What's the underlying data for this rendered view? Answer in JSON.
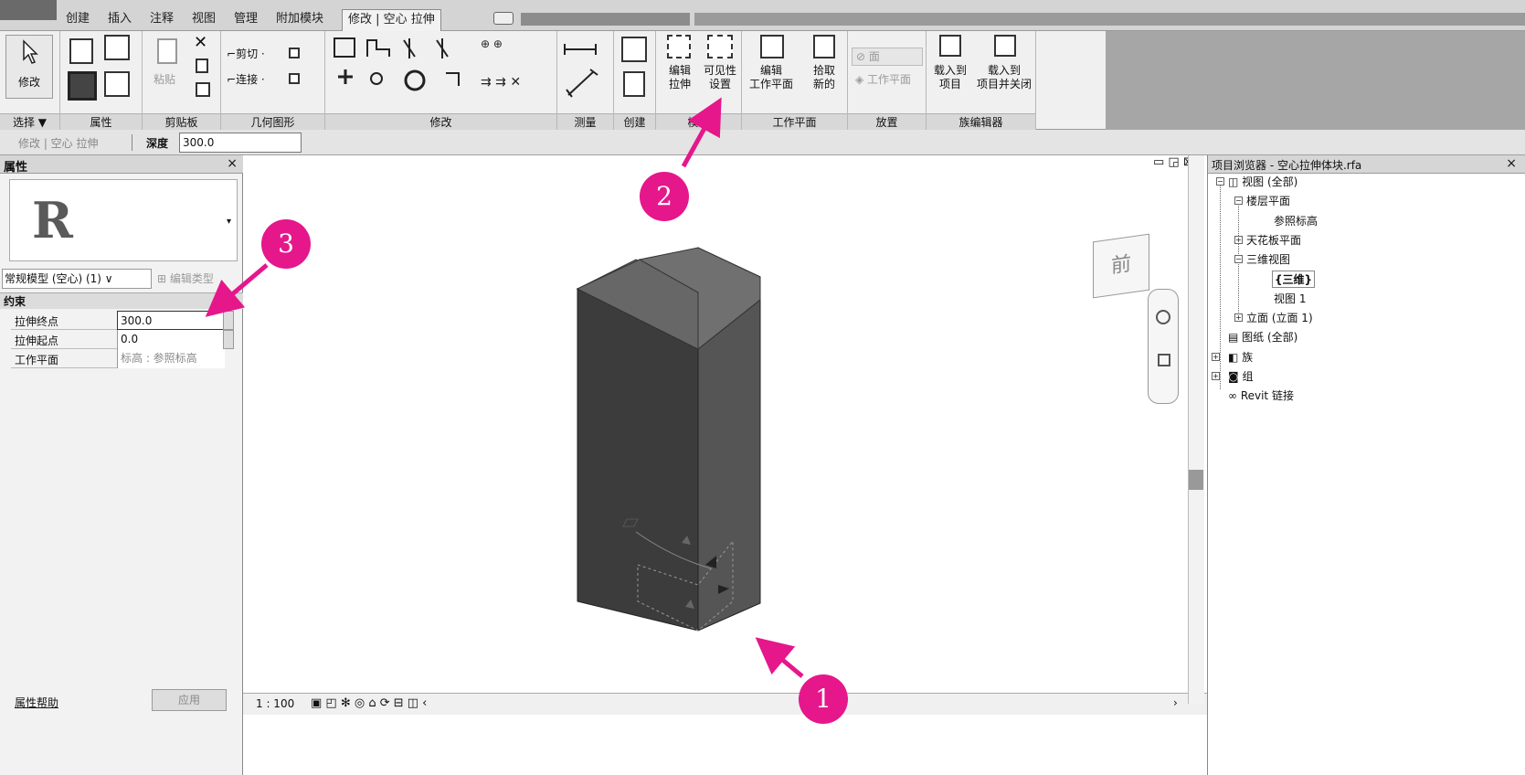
{
  "tabs": [
    "创建",
    "插入",
    "注释",
    "视图",
    "管理",
    "附加模块",
    "修改 | 空心 拉伸"
  ],
  "ribbon": {
    "modify_label": "修改",
    "paste_label": "粘贴",
    "cut_label": "剪切 ·",
    "join_label": "连接 ·",
    "edit_extrusion": [
      "编辑",
      "拉伸"
    ],
    "visibility_settings": [
      "可见性",
      "设置"
    ],
    "edit_workplane": [
      "编辑",
      "工作平面"
    ],
    "pick_new": [
      "拾取",
      "新的"
    ],
    "place_face": "面",
    "place_workplane": "工作平面",
    "load_into_project": [
      "载入到",
      "项目"
    ],
    "load_close": [
      "载入到",
      "项目并关闭"
    ],
    "panels": [
      "选择 ▼",
      "属性",
      "剪贴板",
      "几何图形",
      "修改",
      "测量",
      "创建",
      "模式",
      "工作平面",
      "放置",
      "族编辑器"
    ]
  },
  "optionbar": {
    "context": "修改 | 空心 拉伸",
    "depth_label": "深度",
    "depth_value": "300.0"
  },
  "properties": {
    "title": "属性",
    "close": "×",
    "type_selector": "常规模型 (空心) (1)  ∨",
    "edit_type": "编辑类型",
    "category": "约束",
    "rows": [
      {
        "name": "拉伸终点",
        "value": "300.0"
      },
      {
        "name": "拉伸起点",
        "value": "0.0"
      },
      {
        "name": "工作平面",
        "value": "标高 : 参照标高"
      }
    ],
    "help": "属性帮助",
    "apply": "应用"
  },
  "view": {
    "scale": "1 : 100",
    "viewcube_face": "前",
    "window_controls": "▭ ◲ ⊠"
  },
  "browser": {
    "title": "项目浏览器 - 空心拉伸体块.rfa",
    "close": "×",
    "nodes": [
      "视图 (全部)",
      "楼层平面",
      "参照标高",
      "天花板平面",
      "三维视图",
      "{三维}",
      "视图 1",
      "立面 (立面 1)",
      "图纸 (全部)",
      "族",
      "组",
      "Revit 链接"
    ]
  },
  "annotations": {
    "badge1": "1",
    "badge2": "2",
    "badge3": "3",
    "color": "#e5178b"
  }
}
